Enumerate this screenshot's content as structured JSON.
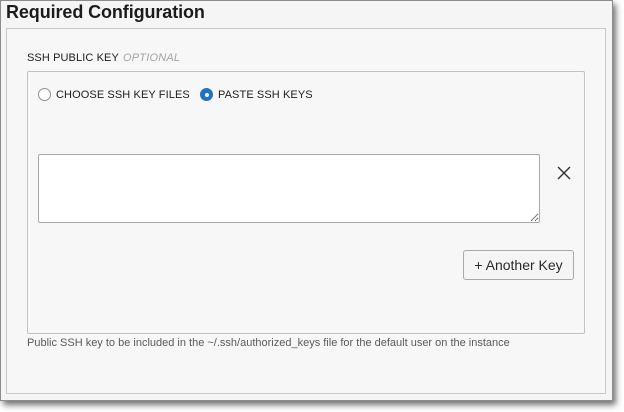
{
  "section": {
    "title": "Required Configuration"
  },
  "ssh_key_field": {
    "label": "SSH PUBLIC KEY",
    "optional_tag": "OPTIONAL",
    "options": [
      {
        "label": "CHOOSE SSH KEY FILES",
        "selected": false
      },
      {
        "label": "PASTE SSH KEYS",
        "selected": true
      }
    ],
    "textarea_value": "",
    "remove_icon": "close-icon",
    "add_button_label": "+ Another Key",
    "help_text": "Public SSH key to be included in the ~/.ssh/authorized_keys file for the default user on the instance"
  },
  "colors": {
    "accent": "#1e73c9",
    "background": "#f5f5f5",
    "border": "#c2c2c2",
    "muted_text": "#a3a3a3"
  }
}
